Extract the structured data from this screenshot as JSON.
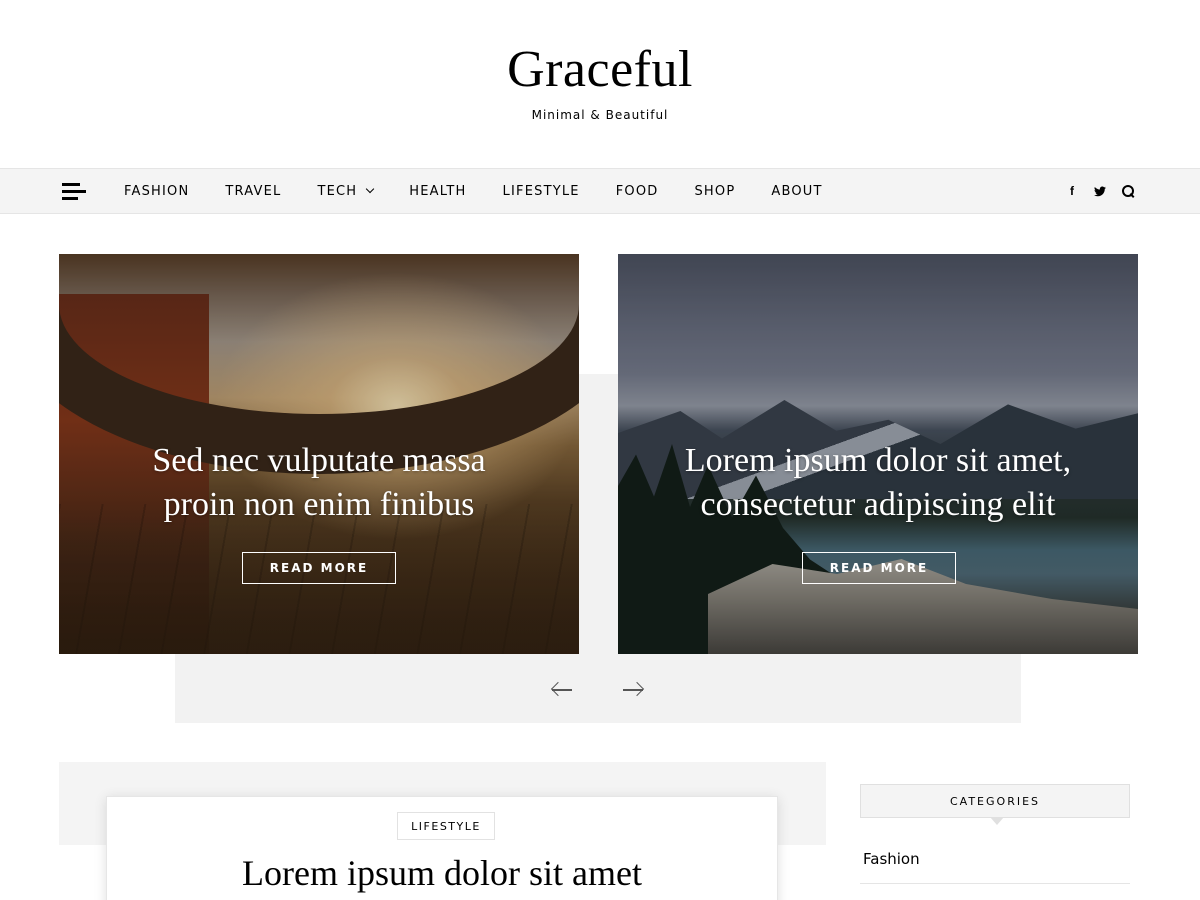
{
  "header": {
    "site_title": "Graceful",
    "tagline": "Minimal & Beautiful"
  },
  "nav": {
    "menu_icon": "hamburger-icon",
    "items": [
      {
        "label": "FASHION"
      },
      {
        "label": "TRAVEL"
      },
      {
        "label": "TECH",
        "has_dropdown": true
      },
      {
        "label": "HEALTH"
      },
      {
        "label": "LIFESTYLE"
      },
      {
        "label": "FOOD"
      },
      {
        "label": "SHOP"
      },
      {
        "label": "ABOUT"
      }
    ],
    "social": {
      "facebook": "f",
      "twitter": "twitter-icon",
      "search": "search-icon"
    }
  },
  "slider": {
    "slides": [
      {
        "title_line1": "Sed nec vulputate massa",
        "title_line2": "proin non enim finibus",
        "button": "READ MORE"
      },
      {
        "title_line1": "Lorem ipsum dolor sit amet,",
        "title_line2": "consectetur adipiscing elit",
        "button": "READ MORE"
      }
    ],
    "prev_icon": "arrow-left-icon",
    "next_icon": "arrow-right-icon"
  },
  "post": {
    "category": "LIFESTYLE",
    "title": "Lorem ipsum dolor sit amet"
  },
  "sidebar": {
    "widget_title": "CATEGORIES",
    "categories": [
      {
        "label": "Fashion"
      }
    ]
  },
  "colors": {
    "nav_background": "#f4f4f4",
    "text": "#000000",
    "slider_background": "#f2f2f2"
  }
}
